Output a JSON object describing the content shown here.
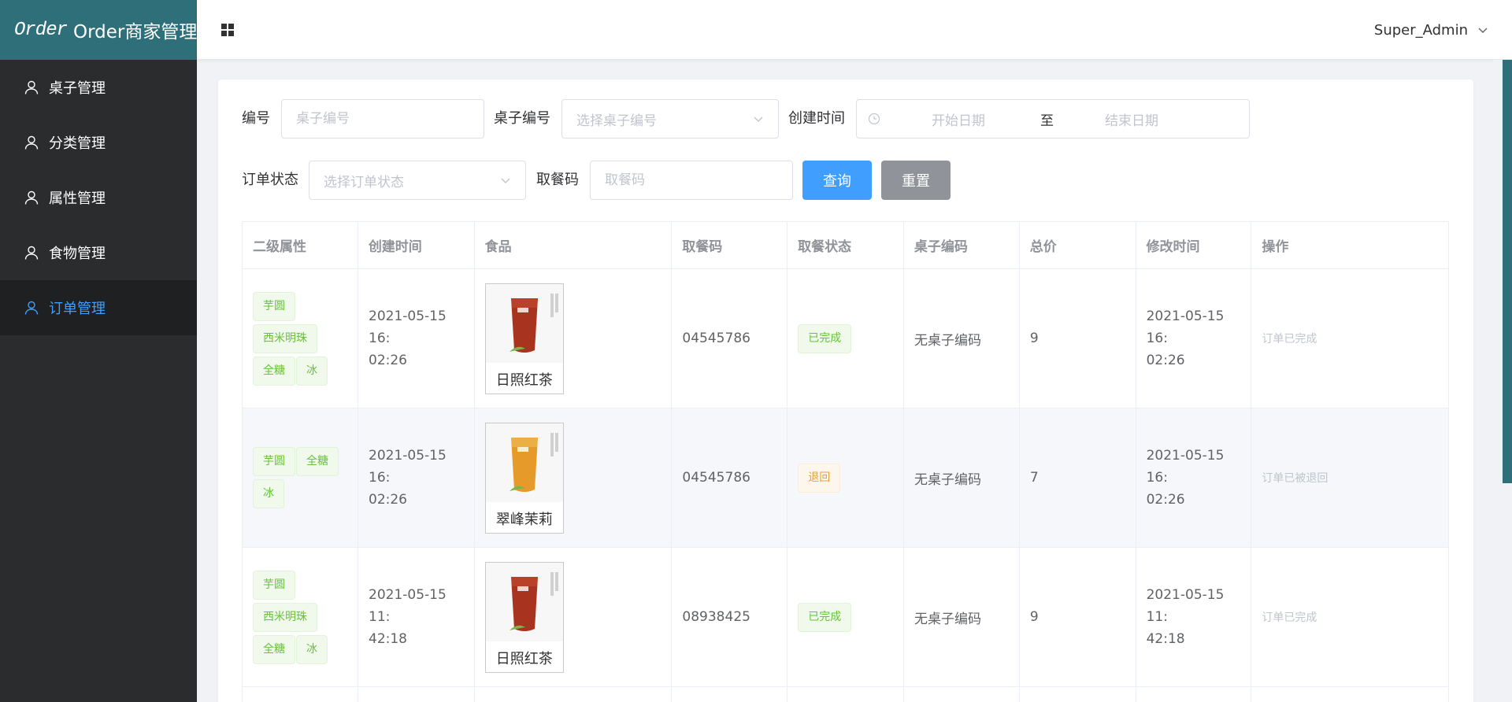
{
  "sidebar": {
    "logo_brand": "Order",
    "logo_title": "Order商家管理",
    "items": [
      {
        "label": "桌子管理"
      },
      {
        "label": "分类管理"
      },
      {
        "label": "属性管理"
      },
      {
        "label": "食物管理"
      },
      {
        "label": "订单管理"
      }
    ]
  },
  "header": {
    "username": "Super_Admin"
  },
  "filters": {
    "id_label": "编号",
    "id_placeholder": "桌子编号",
    "table_label": "桌子编号",
    "table_placeholder": "选择桌子编号",
    "created_label": "创建时间",
    "start_placeholder": "开始日期",
    "range_sep": "至",
    "end_placeholder": "结束日期",
    "status_label": "订单状态",
    "status_placeholder": "选择订单状态",
    "pickup_label": "取餐码",
    "pickup_placeholder": "取餐码",
    "query_button": "查询",
    "reset_button": "重置"
  },
  "table": {
    "columns": [
      "二级属性",
      "创建时间",
      "食品",
      "取餐码",
      "取餐状态",
      "桌子编码",
      "总价",
      "修改时间",
      "操作"
    ],
    "rows": [
      {
        "tags": [
          "芋圆",
          "西米明珠",
          "全糖",
          "冰"
        ],
        "created_a": "2021-05-15 16:",
        "created_b": "02:26",
        "food_name": "日照红茶",
        "pickup_code": "04545786",
        "status": "已完成",
        "table_code": "无桌子编码",
        "total": "9",
        "modified_a": "2021-05-15 16:",
        "modified_b": "02:26",
        "operation": "订单已完成"
      },
      {
        "tags": [
          "芋圆",
          "全糖",
          "冰"
        ],
        "created_a": "2021-05-15 16:",
        "created_b": "02:26",
        "food_name": "翠峰茉莉",
        "pickup_code": "04545786",
        "status": "退回",
        "table_code": "无桌子编码",
        "total": "7",
        "modified_a": "2021-05-15 16:",
        "modified_b": "02:26",
        "operation": "订单已被退回"
      },
      {
        "tags": [
          "芋圆",
          "西米明珠",
          "全糖",
          "冰"
        ],
        "created_a": "2021-05-15 11:",
        "created_b": "42:18",
        "food_name": "日照红茶",
        "pickup_code": "08938425",
        "status": "已完成",
        "table_code": "无桌子编码",
        "total": "9",
        "modified_a": "2021-05-15 11:",
        "modified_b": "42:18",
        "operation": "订单已完成"
      }
    ]
  },
  "colors": {
    "logo_bg": "#2e6f7a",
    "sidebar_bg": "#2b2c2e",
    "active": "#409eff",
    "success": "#67c23a",
    "warning": "#e6a23c",
    "red_tea": "#a8331f",
    "jasmine_tea": "#e59a2a"
  },
  "icons": [
    "user-icon",
    "grid-icon",
    "chevron-down-icon",
    "clock-icon"
  ]
}
